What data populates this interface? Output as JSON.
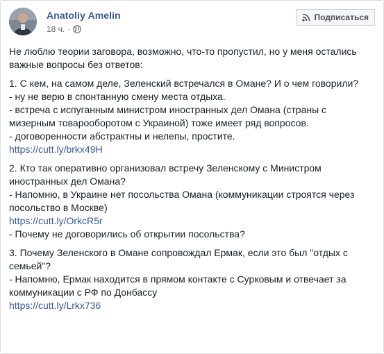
{
  "post": {
    "author": "Anatoliy Amelin",
    "time": "18 ч.",
    "separator": "·",
    "privacy_icon": "globe-icon",
    "subscribe_icon": "rss-icon",
    "subscribe_label": "Подписаться",
    "paragraphs": [
      {
        "lines": [
          {
            "text": "Не люблю теории заговора, возможно, что-то пропустил, но у меня остались важные вопросы без ответов:",
            "link": false
          }
        ]
      },
      {
        "lines": [
          {
            "text": "1. С кем, на самом деле, Зеленский встречался в Омане? И о чем говорили?",
            "link": false
          },
          {
            "text": "- ну не верю в спонтанную смену места отдыха.",
            "link": false
          },
          {
            "text": "- встреча с испуганным министром иностранных дел Омана (страны с мизерным товарооборотом с Украиной) тоже имеет ряд вопросов.",
            "link": false
          },
          {
            "text": "- договоренности абстрактны и нелепы, простите.",
            "link": false
          },
          {
            "text": "https://cutt.ly/brkx49H",
            "link": true
          }
        ]
      },
      {
        "lines": [
          {
            "text": "2. Кто так оперативно организовал встречу Зеленскому с Министром иностранных дел Омана?",
            "link": false
          },
          {
            "text": "- Напомню, в Украине нет посольства Омана (коммуникации строятся через посольство в Москве)",
            "link": false
          },
          {
            "text": "https://cutt.ly/OrkcR5r",
            "link": true
          },
          {
            "text": "- Почему не договорились об открытии посольства?",
            "link": false
          }
        ]
      },
      {
        "lines": [
          {
            "text": "3. Почему Зеленского в Омане сопровождал Ермак, если это был \"отдых с семьей\"?",
            "link": false
          },
          {
            "text": "- Напомню, Ермак находится в прямом контакте с Сурковым и отвечает за коммуникации с РФ по Донбассу",
            "link": false
          },
          {
            "text": "https://cutt.ly/Lrkx736",
            "link": true
          }
        ]
      }
    ]
  },
  "colors": {
    "author": "#385898",
    "link": "#385898",
    "text": "#1c1e21",
    "meta": "#616770"
  }
}
